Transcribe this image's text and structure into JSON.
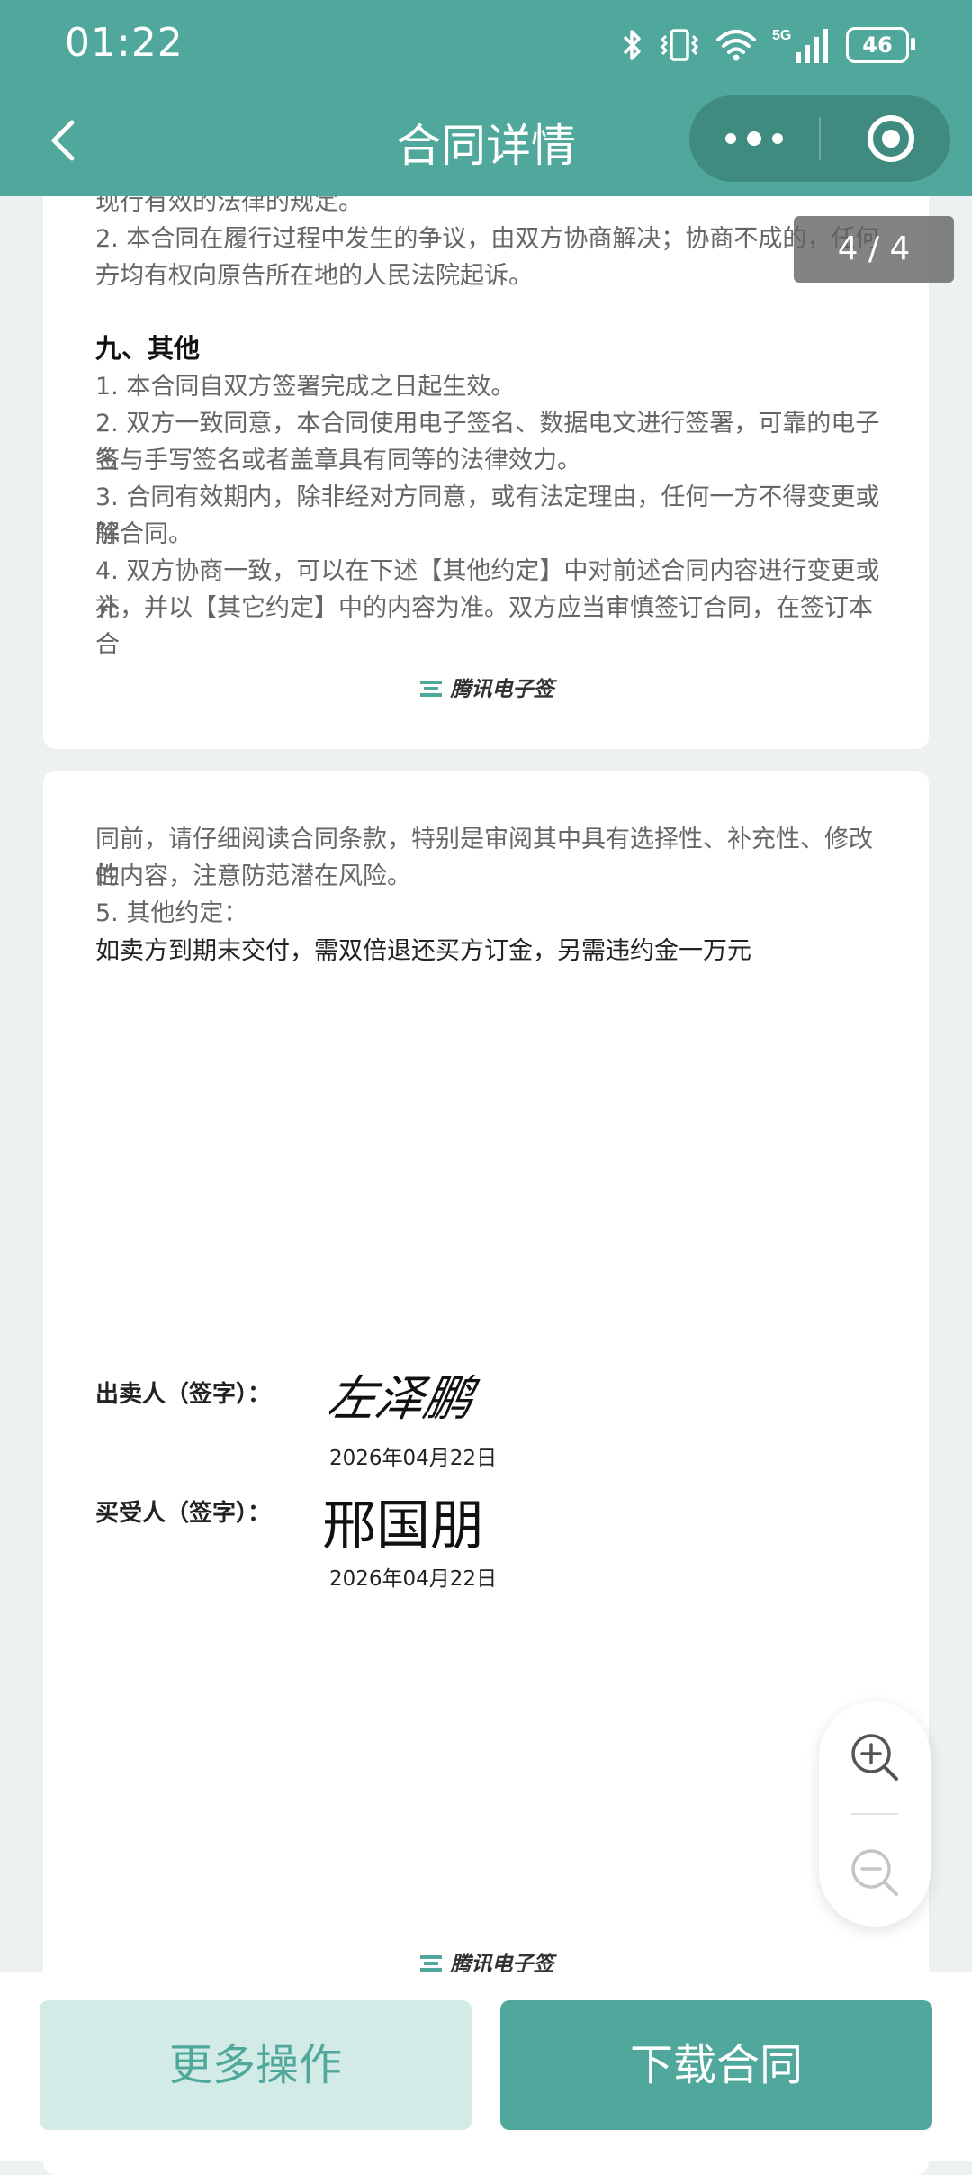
{
  "status": {
    "time": "01:22",
    "battery": "46",
    "network": "5G"
  },
  "nav": {
    "title": "合同详情"
  },
  "page_indicator": "4 / 4",
  "page1": {
    "lines": [
      "现行有效的法律的规定。",
      "2. 本合同在履行过程中发生的争议，由双方协商解决；协商不成的，任何一",
      "方均有权向原告所在地的人民法院起诉。"
    ],
    "section_title": "九、其他",
    "items": [
      "1. 本合同自双方签署完成之日起生效。",
      "2. 双方一致同意，本合同使用电子签名、数据电文进行签署，可靠的电子签",
      "名与手写签名或者盖章具有同等的法律效力。",
      "3. 合同有效期内，除非经对方同意，或有法定理由，任何一方不得变更或解",
      "除合同。",
      "4. 双方协商一致，可以在下述【其他约定】中对前述合同内容进行变更或补",
      "充，并以【其它约定】中的内容为准。双方应当审慎签订合同，在签订本合"
    ],
    "brand": "腾讯电子签"
  },
  "page2": {
    "lines": [
      "同前，请仔细阅读合同条款，特别是审阅其中具有选择性、补充性、修改性",
      "的内容，注意防范潜在风险。",
      "5. 其他约定："
    ],
    "other_agreement": "如卖方到期末交付，需双倍退还买方订金，另需违约金一万元",
    "seller_label": "出卖人（签字）：",
    "seller_signature": "左泽鹏",
    "seller_date": "2026年04月22日",
    "buyer_label": "买受人（签字）：",
    "buyer_signature": "邢国朋",
    "buyer_date": "2026年04月22日",
    "brand": "腾讯电子签"
  },
  "actions": {
    "more": "更多操作",
    "download": "下载合同"
  },
  "colors": {
    "primary": "#4fa89b",
    "primary_light": "#d3ebe7"
  }
}
